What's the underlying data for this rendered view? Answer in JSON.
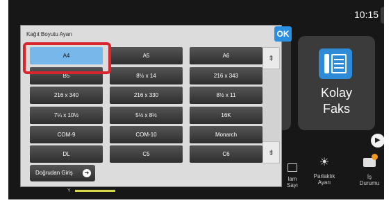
{
  "status": {
    "time": "10:15",
    "side_handle_icon": "collapse-arrow-icon"
  },
  "background": {
    "tile": {
      "label_line1": "Kolay",
      "label_line2": "Faks",
      "icon": "fax-document-icon",
      "icon_color": "#2f8bd8"
    },
    "bottom_icons": [
      {
        "name": "counter-icon",
        "line1": "lam",
        "line2": "Sayı"
      },
      {
        "name": "brightness-icon",
        "line1": "Parlaklık",
        "line2": "Ayarı"
      },
      {
        "name": "job-status-icon",
        "line1": "İş",
        "line2": "Durumu",
        "badge_color": "#f29a1d"
      }
    ],
    "toner_label": "Y",
    "toner_color": "#d5d84a"
  },
  "dialog": {
    "title": "Kağıt Boyutu Ayarı",
    "ok_label": "OK",
    "direct_entry_label": "Doğrudan Giriş",
    "selected": "A4",
    "highlight_color": "#d9262d",
    "sizes": [
      [
        "A4",
        "A5",
        "A6"
      ],
      [
        "B5",
        "8½ x 14",
        "216 x 343"
      ],
      [
        "216 x 340",
        "216 x 330",
        "8½ x 11"
      ],
      [
        "7¼ x 10½",
        "5½ x 8½",
        "16K"
      ],
      [
        "COM-9",
        "COM-10",
        "Monarch"
      ],
      [
        "DL",
        "C5",
        "C6"
      ]
    ],
    "scroll_up_icon": "double-chevron-up-icon",
    "scroll_down_icon": "double-chevron-down-icon"
  }
}
